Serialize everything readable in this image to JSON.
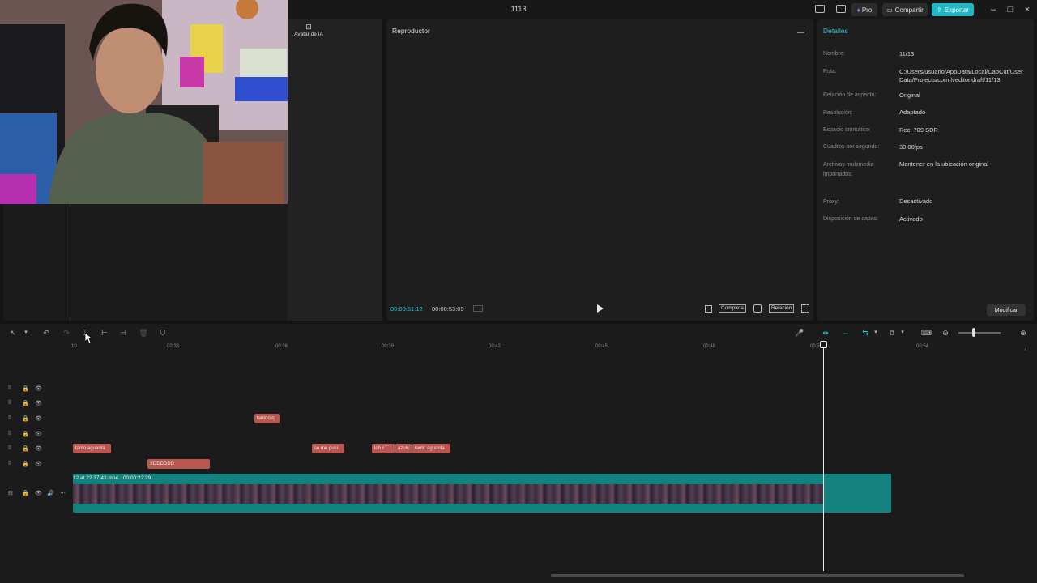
{
  "titlebar": {
    "title": "1113",
    "pro_label": "Pro",
    "share_label": "Compartir",
    "export_label": "Exportar"
  },
  "media": {
    "ai_avatar_label": "Avatar de IA"
  },
  "player": {
    "title": "Reproductor",
    "time_current": "00:00:51:12",
    "time_total": "00:00:53:09",
    "full_label": "Completa",
    "ratio_label": "Relación"
  },
  "details": {
    "title": "Detalles",
    "rows": [
      {
        "label": "Nombre:",
        "value": "11/13"
      },
      {
        "label": "Ruta:",
        "value": "C:/Users/usuario/AppData/Local/CapCut/User Data/Projects/com.lveditor.draft/11/13"
      },
      {
        "label": "Relación de aspecto:",
        "value": "Original"
      },
      {
        "label": "Resolución:",
        "value": "Adaptado"
      },
      {
        "label": "Espacio cromático:",
        "value": "Rec. 709 SDR"
      },
      {
        "label": "Cuadros por segundo:",
        "value": "30.00fps"
      },
      {
        "label": "Archivos multimedia importados:",
        "value": "Mantener en la ubicación original"
      },
      {
        "label": "Proxy:",
        "value": "Desactivado"
      },
      {
        "label": "Disposición de capas:",
        "value": "Activado"
      }
    ],
    "modify_label": "Modificar"
  },
  "timeline": {
    "ticks": [
      "10",
      "00:33",
      "00:36",
      "00:39",
      "00:42",
      "00:45",
      "00:48",
      "00:51",
      "00:54"
    ],
    "text_clips": [
      {
        "text": "tantoo q"
      },
      {
        "text": "tanto aguanta"
      },
      {
        "text": "se me pusi"
      },
      {
        "text": "loh c´´´"
      },
      {
        "text": "azulc"
      },
      {
        "text": "tanto aguanta"
      },
      {
        "text": "XDDDDDD"
      }
    ],
    "video_clip": {
      "name": "12 at 22.37.43.mp4",
      "duration": "00:00:22:29"
    }
  },
  "colors": {
    "accent": "#1fb8c4",
    "text_clip": "#b8564f",
    "video_clip": "#13817d"
  }
}
